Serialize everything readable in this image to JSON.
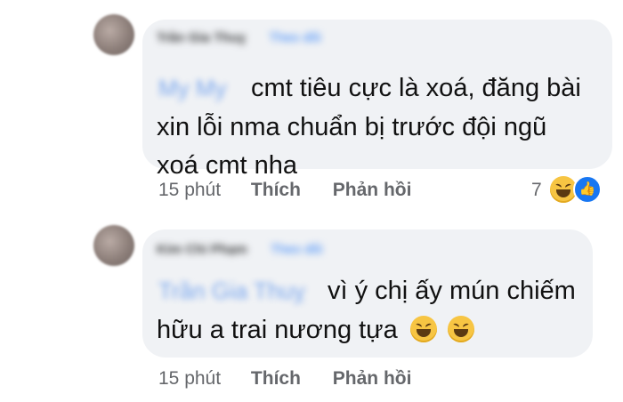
{
  "comments": [
    {
      "author": "Trần Gia Thuỵ",
      "follow": "Theo dõi",
      "mention": "My My",
      "text_lines": [
        "cmt tiêu cực là xoá, đăng bài",
        "xin lỗi nma chuẩn bị trước đội ngũ",
        "xoá cmt nha"
      ],
      "time": "15 phút",
      "like_label": "Thích",
      "reply_label": "Phản hồi",
      "reaction_count": "7",
      "reactions": [
        "laughing-emoji",
        "like-icon"
      ]
    },
    {
      "author": "Kim Chi Phạm",
      "follow": "Theo dõi",
      "mention": "Trần Gia Thuỵ",
      "text_lines": [
        "vì ý chị ấy mún chiếm",
        "hữu a trai nương tựa"
      ],
      "time": "15 phút",
      "like_label": "Thích",
      "reply_label": "Phản hồi",
      "inline_emojis": [
        "laughing-emoji",
        "laughing-emoji"
      ]
    }
  ]
}
